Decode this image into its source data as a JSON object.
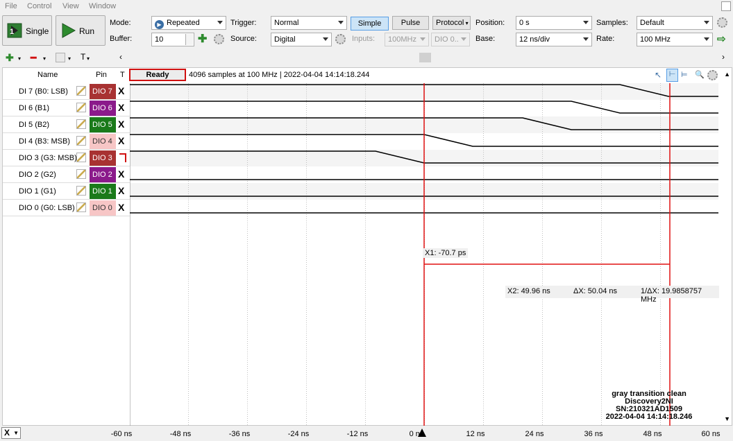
{
  "menu": [
    "File",
    "Control",
    "View",
    "Window"
  ],
  "toolbar": {
    "single_label": "Single",
    "run_label": "Run",
    "mode_label": "Mode:",
    "mode_value": "Repeated",
    "buffer_label": "Buffer:",
    "buffer_value": "10",
    "trigger_label": "Trigger:",
    "trigger_value": "Normal",
    "source_label": "Source:",
    "source_value": "Digital",
    "simple_label": "Simple",
    "pulse_label": "Pulse",
    "protocol_label": "Protocol",
    "inputs_label": "Inputs:",
    "inputs_value": "100MHz",
    "inputs_channel": "DIO 0..",
    "position_label": "Position:",
    "position_value": "0 s",
    "base_label": "Base:",
    "base_value": "12 ns/div",
    "samples_label": "Samples:",
    "samples_value": "Default",
    "rate_label": "Rate:",
    "rate_value": "100 MHz"
  },
  "columns": {
    "name": "Name",
    "pin": "Pin",
    "trigger": "T"
  },
  "status": {
    "state": "Ready",
    "info": "4096 samples at 100 MHz | 2022-04-04 14:14:18.244"
  },
  "channels": [
    {
      "name": "DI 7 (B0: LSB)",
      "pin": "DIO 7",
      "pin_color": "#a83232",
      "trigger": "X"
    },
    {
      "name": "DI 6 (B1)",
      "pin": "DIO 6",
      "pin_color": "#8b1a8b",
      "trigger": "X"
    },
    {
      "name": "DI 5 (B2)",
      "pin": "DIO 5",
      "pin_color": "#1a7a1a",
      "trigger": "X"
    },
    {
      "name": "DI 4 (B3: MSB)",
      "pin": "DIO 4",
      "pin_color": "#f7c6c6",
      "trigger": "X"
    },
    {
      "name": "DIO 3 (G3: MSB)",
      "pin": "DIO 3",
      "pin_color": "#a83232",
      "trigger": "rise"
    },
    {
      "name": "DIO 2 (G2)",
      "pin": "DIO 2",
      "pin_color": "#8b1a8b",
      "trigger": "X"
    },
    {
      "name": "DIO 1 (G1)",
      "pin": "DIO 1",
      "pin_color": "#1a7a1a",
      "trigger": "X"
    },
    {
      "name": "DIO 0 (G0: LSB)",
      "pin": "DIO 0",
      "pin_color": "#f7c6c6",
      "trigger": "X"
    }
  ],
  "cursors": {
    "x1": "X1: -70.7 ps",
    "x2": "X2: 49.96 ns",
    "dx": "ΔX: 50.04 ns",
    "inv_dx": "1/ΔX: 19.9858757 MHz"
  },
  "x_axis": {
    "button": "X",
    "ticks": [
      "-60 ns",
      "-48 ns",
      "-36 ns",
      "-24 ns",
      "-12 ns",
      "0 ns",
      "12 ns",
      "24 ns",
      "36 ns",
      "48 ns",
      "60 ns"
    ]
  },
  "note": [
    "gray transition clean",
    "Discovery2NI",
    "SN:210321AD1509",
    "2022-04-04 14:14:18.246"
  ],
  "colors": {
    "cursor": "#e01010",
    "accent": "#569de5",
    "trace": "#000000"
  }
}
